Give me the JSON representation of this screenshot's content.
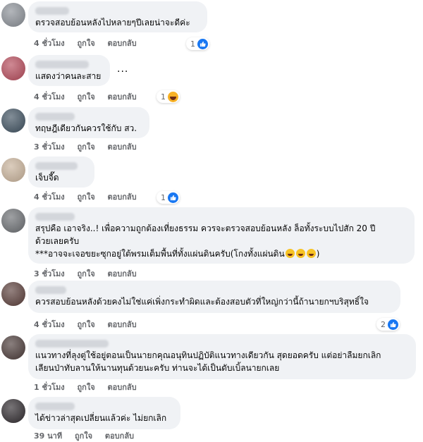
{
  "labels": {
    "like": "ถูกใจ",
    "reply": "ตอบกลับ"
  },
  "colors": {
    "bubble": "#f0f2f5",
    "like_blue": "#1877f2",
    "meta_gray": "#65676b"
  },
  "comments": [
    {
      "text": "ตรวจสอบย้อนหลังไปหลายๆปีเลยน่าจะดีค่ะ",
      "time": "4 ชั่วโมง",
      "reaction_count": "1",
      "reaction_icon": "like-icon"
    },
    {
      "text": "แสดงว่าคนละสาย",
      "time": "4 ชั่วโมง",
      "reaction_count": "1",
      "reaction_icon": "haha-icon",
      "more_label": "..."
    },
    {
      "text": "ทฤษฎีเดียวกันควรใช้กับ สว.",
      "time": "3 ชั่วโมง"
    },
    {
      "text": "เจ็บจี๊ด",
      "time": "4 ชั่วโมง",
      "reaction_count": "1",
      "reaction_icon": "like-icon"
    },
    {
      "text_line1": "สรุปคือ เอาจริง..! เพื่อความถูกต้องเที่ยงธรรม ควรจะตรวจสอบย้อนหลัง ล็อทั้งระบบไปสัก 20 ปี",
      "text_line2": "ด้วยเลยครับ",
      "text_line3": "***อาจจะเจอขยะซุกอยู่ใต้พรมเต็มพื้นที่ทั้งแผ่นดินครับ(โกงทั้งแผ่นดิน",
      "text_line3_end": ")",
      "time": "3 ชั่วโมง"
    },
    {
      "text": "ควรสอบย้อนหลังด้วยคงไม่ใช่แค่เพิ่งกระทำผิดและต้องสอบตัวที่ใหญ่กว่านี้ถ้านายกฯบริสุทธิ์ใจ",
      "time": "4 ชั่วโมง",
      "reaction_count": "2",
      "reaction_icon": "like-icon"
    },
    {
      "text_line1": "แนวทางที่ลุงตู่ใช้อยู่ตอนเป็นนายกคุณอนุทินปฏิบัติแนวทางเดียวกัน สุดยอดครับ แต่อย่าลืมยกเลิก",
      "text_line2": "เลียนป่าทับลานให้นานทุนด้วยนะครับ ท่านจะได้เป็นดับเบิ้ลนายกเลย",
      "time": "1 ชั่วโมง"
    },
    {
      "text": "ได้ข่าวล่าสุดเปลี่ยนแล้วค่ะ ไม่ยกเลิก",
      "time": "39 นาที"
    }
  ]
}
